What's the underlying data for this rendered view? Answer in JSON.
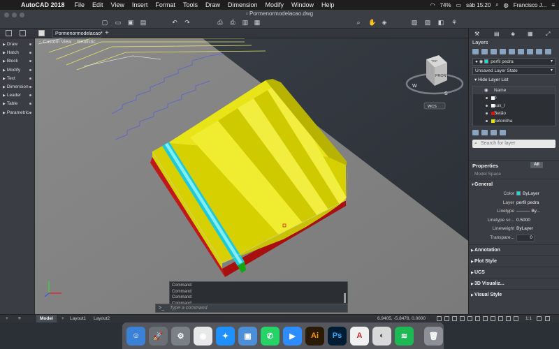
{
  "menubar": {
    "app": "AutoCAD 2018",
    "items": [
      "File",
      "Edit",
      "View",
      "Insert",
      "Format",
      "Tools",
      "Draw",
      "Dimension",
      "Modify",
      "Window",
      "Help"
    ],
    "battery": "74%",
    "clock": "sáb 15:20",
    "user": "Francisco J..."
  },
  "document": {
    "title": "Pormenormodelacao.dwg",
    "tab": "Pormenormodelacao*"
  },
  "viewport": {
    "view": "Custom View",
    "style": "Realistic",
    "minus": "-",
    "wcs": "WCS",
    "cube_top": "TOP",
    "cube_front": "FRONT",
    "compass_s": "S",
    "compass_w": "W"
  },
  "palette": {
    "items": [
      "Draw",
      "Hatch",
      "Block",
      "Modify",
      "Text",
      "Dimension",
      "Leader",
      "Table",
      "Parametric"
    ]
  },
  "command": {
    "history": [
      "Command:",
      "Command:",
      "Command:",
      "Command:"
    ],
    "prompt": ">_",
    "placeholder": "Type a command"
  },
  "status": {
    "tabs": [
      "Model",
      "Layout1",
      "Layout2"
    ],
    "coords": "6.9405, -5.8478, 0.0000",
    "scale": "1:1"
  },
  "layers": {
    "title": "Layers",
    "current": "perfil pedra",
    "current_color": "#00e5e5",
    "state": "Unsaved Layer State",
    "hide_list": "Hide Layer List",
    "header": "Name",
    "rows": [
      {
        "name": "0",
        "color": "#ffffff"
      },
      {
        "name": "aux_l",
        "color": "#ffffff"
      },
      {
        "name": "Betão",
        "color": "#e01010"
      },
      {
        "name": "betonilha",
        "color": "#e0e000"
      }
    ],
    "search_placeholder": "Search for layer"
  },
  "properties": {
    "title": "Properties",
    "filter": "All",
    "space": "Model Space",
    "general_group": "General",
    "rows": [
      {
        "label": "Color",
        "value": "ByLayer"
      },
      {
        "label": "Layer",
        "value": "perfil pedra"
      },
      {
        "label": "Linetype",
        "value": "By..."
      },
      {
        "label": "Linetype sc...",
        "value": "0.5000"
      },
      {
        "label": "Lineweight",
        "value": "ByLayer"
      },
      {
        "label": "Transpare...",
        "value": "0"
      }
    ],
    "groups": [
      "Annotation",
      "Plot Style",
      "UCS",
      "3D Visualiz...",
      "Visual Style"
    ]
  },
  "dock": [
    {
      "name": "finder",
      "color": "#3b82d6",
      "glyph": "☺"
    },
    {
      "name": "launchpad",
      "color": "#6b6f76",
      "glyph": "🚀"
    },
    {
      "name": "system-preferences",
      "color": "#7b7f86",
      "glyph": "⚙"
    },
    {
      "name": "chrome",
      "color": "#e8e8e8",
      "glyph": "◉"
    },
    {
      "name": "safari",
      "color": "#1e90ff",
      "glyph": "✦"
    },
    {
      "name": "preview",
      "color": "#4c8fd8",
      "glyph": "▣"
    },
    {
      "name": "whatsapp",
      "color": "#25d366",
      "glyph": "✆"
    },
    {
      "name": "zoom",
      "color": "#2d8cff",
      "glyph": "▶"
    },
    {
      "name": "illustrator",
      "color": "#2b1a05",
      "glyph": "Ai",
      "fg": "#ff9a00"
    },
    {
      "name": "photoshop",
      "color": "#001d34",
      "glyph": "Ps",
      "fg": "#31a8ff"
    },
    {
      "name": "autocad",
      "color": "#f0f0f0",
      "glyph": "A",
      "fg": "#d01f1f"
    },
    {
      "name": "exp",
      "color": "#d8d8d8",
      "glyph": "◐",
      "fg": "#333"
    },
    {
      "name": "spotify",
      "color": "#1db954",
      "glyph": "≋"
    },
    {
      "name": "trash",
      "color": "#8d9197",
      "glyph": "🗑"
    }
  ]
}
